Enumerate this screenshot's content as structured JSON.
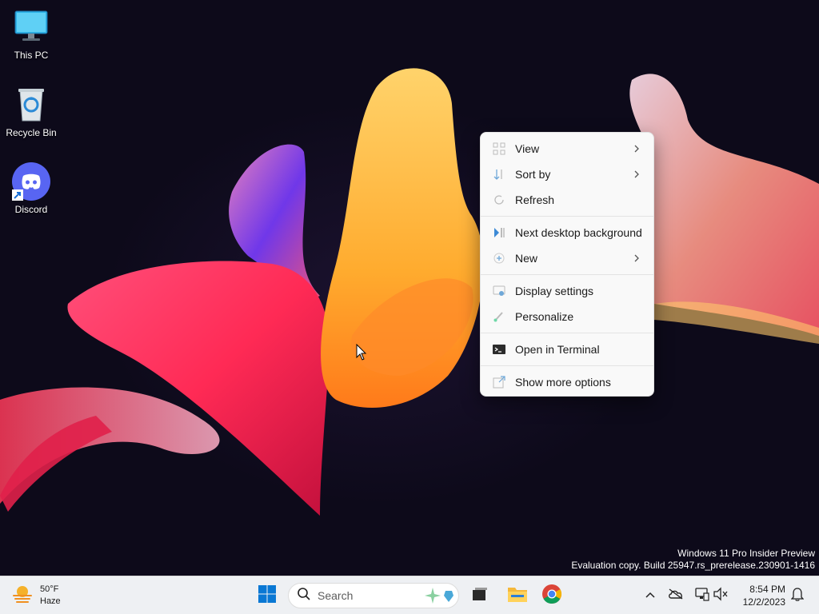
{
  "desktop": {
    "icons": [
      {
        "label": "This PC",
        "icon": "this-pc-icon"
      },
      {
        "label": "Recycle Bin",
        "icon": "recycle-bin-icon"
      },
      {
        "label": "Discord",
        "icon": "discord-icon"
      }
    ]
  },
  "context_menu": {
    "items": [
      {
        "label": "View",
        "icon": "view-grid-icon",
        "submenu": true
      },
      {
        "label": "Sort by",
        "icon": "sort-icon",
        "submenu": true
      },
      {
        "label": "Refresh",
        "icon": "refresh-icon",
        "submenu": false
      },
      {
        "label": "Next desktop background",
        "icon": "next-background-icon",
        "submenu": false
      },
      {
        "label": "New",
        "icon": "new-plus-icon",
        "submenu": true
      },
      {
        "label": "Display settings",
        "icon": "display-settings-icon",
        "submenu": false
      },
      {
        "label": "Personalize",
        "icon": "personalize-brush-icon",
        "submenu": false
      },
      {
        "label": "Open in Terminal",
        "icon": "terminal-icon",
        "submenu": false
      },
      {
        "label": "Show more options",
        "icon": "more-options-icon",
        "submenu": false
      }
    ]
  },
  "watermark": {
    "line1": "Windows 11 Pro Insider Preview",
    "line2": "Evaluation copy. Build 25947.rs_prerelease.230901-1416"
  },
  "taskbar": {
    "weather": {
      "temp": "50°F",
      "condition": "Haze",
      "icon": "weather-haze-icon"
    },
    "search": {
      "placeholder": "Search"
    },
    "pinned": [
      "start-icon",
      "task-view-icon",
      "file-explorer-icon",
      "chrome-icon"
    ],
    "tray": [
      "chevron-up-icon",
      "onedrive-icon",
      "network-icon",
      "volume-muted-icon"
    ],
    "clock": {
      "time": "8:54 PM",
      "date": "12/2/2023"
    },
    "notification_icon": "notification-bell-icon"
  },
  "colors": {
    "taskbar_bg": "#eef0f3",
    "menu_bg": "#f9f9f9",
    "desktop_bg": "#0d0a1a",
    "accent": "#0067c0"
  }
}
